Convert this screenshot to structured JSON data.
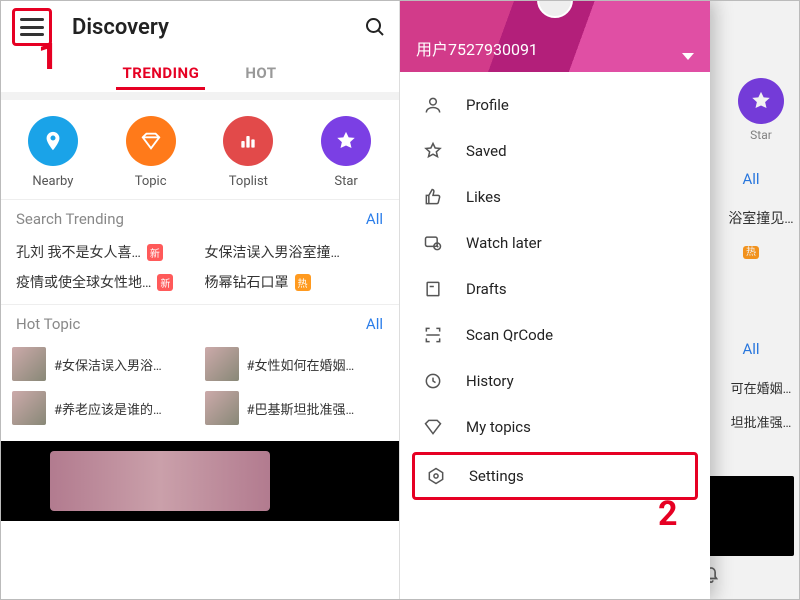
{
  "callouts": {
    "one": "1",
    "two": "2"
  },
  "screen1": {
    "title": "Discovery",
    "tabs": {
      "trending": "TRENDING",
      "hot": "HOT"
    },
    "categories": [
      {
        "key": "nearby",
        "label": "Nearby",
        "color": "c-blue"
      },
      {
        "key": "topic",
        "label": "Topic",
        "color": "c-orange"
      },
      {
        "key": "toplist",
        "label": "Toplist",
        "color": "c-red"
      },
      {
        "key": "star",
        "label": "Star",
        "color": "c-purple"
      }
    ],
    "search_trending": {
      "title": "Search Trending",
      "all": "All",
      "items": [
        {
          "text": "孔刘 我不是女人喜…",
          "badge": "新",
          "badge_kind": "new"
        },
        {
          "text": "女保洁误入男浴室撞见…"
        },
        {
          "text": "疫情或使全球女性地…",
          "badge": "新",
          "badge_kind": "new"
        },
        {
          "text": "杨幂钻石口罩",
          "badge": "热",
          "badge_kind": "hot"
        }
      ]
    },
    "hot_topic": {
      "title": "Hot Topic",
      "all": "All",
      "items": [
        {
          "text": "#女保洁误入男浴…"
        },
        {
          "text": "#女性如何在婚姻…"
        },
        {
          "text": "#养老应该是谁的…"
        },
        {
          "text": "#巴基斯坦批准强…"
        }
      ]
    }
  },
  "screen2": {
    "user": "用户7527930091",
    "menu": [
      {
        "key": "profile",
        "label": "Profile"
      },
      {
        "key": "saved",
        "label": "Saved"
      },
      {
        "key": "likes",
        "label": "Likes"
      },
      {
        "key": "watch-later",
        "label": "Watch later"
      },
      {
        "key": "drafts",
        "label": "Drafts"
      },
      {
        "key": "scan-qr",
        "label": "Scan QrCode"
      },
      {
        "key": "history",
        "label": "History"
      },
      {
        "key": "my-topics",
        "label": "My topics"
      },
      {
        "key": "settings",
        "label": "Settings"
      }
    ],
    "ghost": {
      "star_label": "Star",
      "all": "All",
      "row1": "浴室撞见…",
      "row2": "可在婚姻…",
      "row3": "坦批准强…",
      "hot_badge": "热"
    }
  }
}
